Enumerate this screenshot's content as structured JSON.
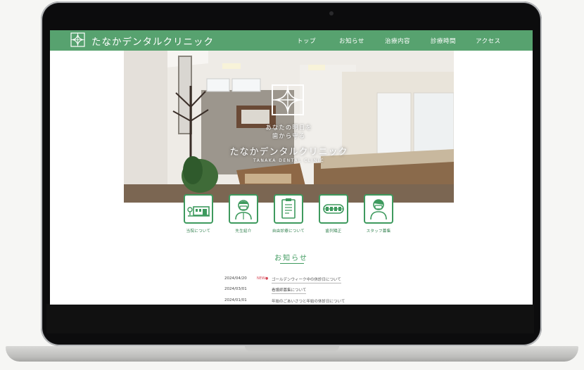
{
  "site": {
    "title": "たなかデンタルクリニック",
    "brand_color": "#57a26f"
  },
  "nav": {
    "items": [
      {
        "label": "トップ"
      },
      {
        "label": "お知らせ"
      },
      {
        "label": "治療内容"
      },
      {
        "label": "診療時間"
      },
      {
        "label": "アクセス"
      }
    ]
  },
  "hero": {
    "tagline_1": "あなたの明日を",
    "tagline_2": "歯から守る",
    "name": "たなかデンタルクリニック",
    "name_en": "TANAKA DENTAL CLINIC"
  },
  "menu": {
    "items": [
      {
        "label": "当院について",
        "icon": "clinic-building-icon"
      },
      {
        "label": "先生紹介",
        "icon": "doctor-icon"
      },
      {
        "label": "自由診療について",
        "icon": "clipboard-icon"
      },
      {
        "label": "歯列矯正",
        "icon": "teeth-braces-icon"
      },
      {
        "label": "スタッフ募集",
        "icon": "staff-icon"
      }
    ]
  },
  "news": {
    "heading": "お知らせ",
    "items": [
      {
        "date": "2024/04/20",
        "badge": "NEW●",
        "title": "ゴールデンウィーク中の休診日について"
      },
      {
        "date": "2024/03/01",
        "badge": "",
        "title": "看護師募集について"
      },
      {
        "date": "2024/01/01",
        "badge": "",
        "title": "年始のごあいさつと年始の休診日について"
      }
    ]
  }
}
